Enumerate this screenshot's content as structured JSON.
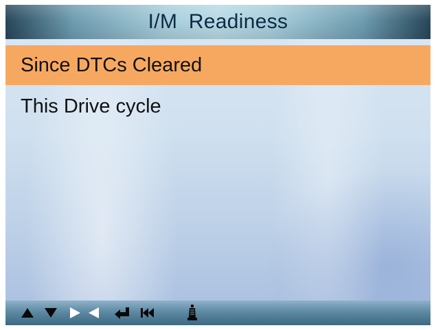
{
  "title": "I/M  Readiness",
  "menu": {
    "items": [
      {
        "label": "Since DTCs Cleared",
        "selected": true
      },
      {
        "label": "This Drive cycle",
        "selected": false
      }
    ]
  },
  "colors": {
    "selection": "#f7a860",
    "title_text": "#0f2a44",
    "key_dark": "#0a0a0a",
    "key_light": "#ffffff"
  },
  "bottom_keys": [
    "up-arrow-icon",
    "down-arrow-icon",
    "right-arrow-icon",
    "left-arrow-icon",
    "enter-icon",
    "back-icon",
    "help-icon"
  ]
}
